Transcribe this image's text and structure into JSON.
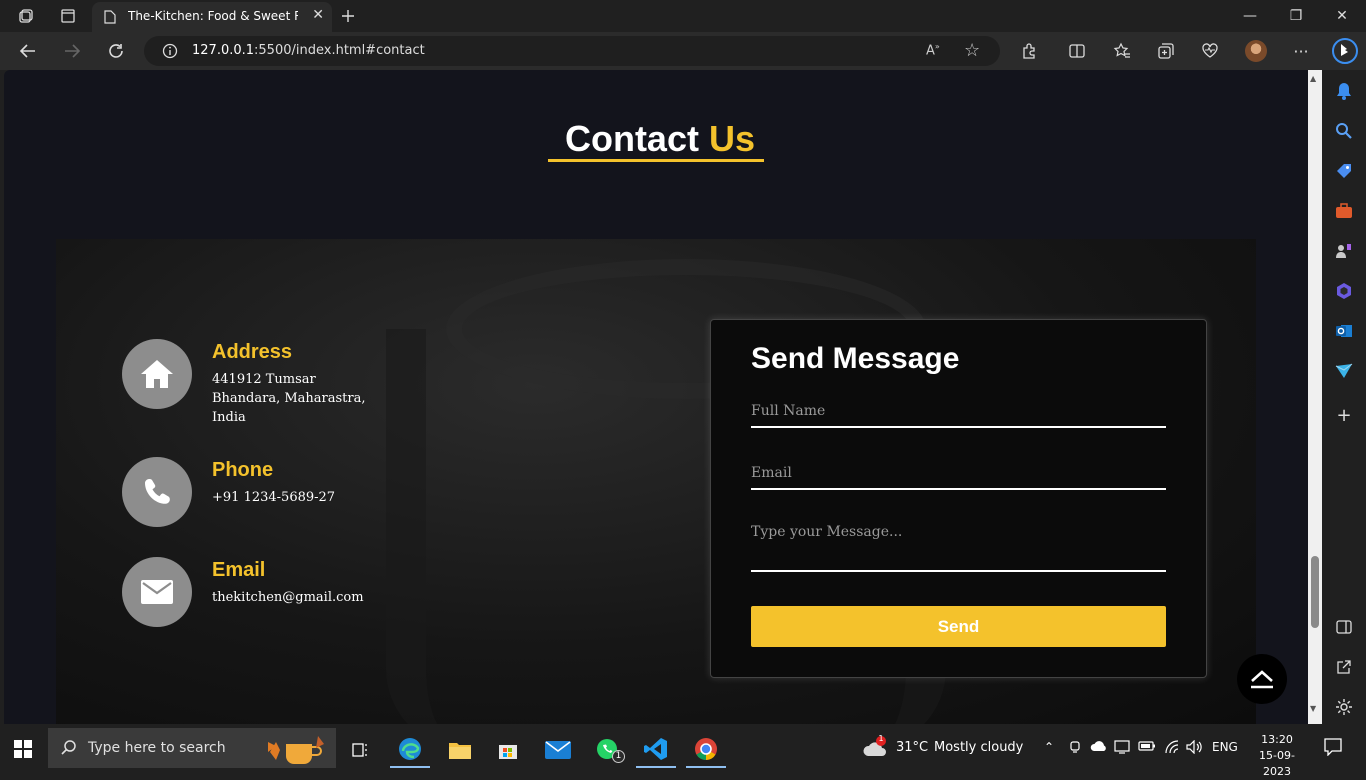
{
  "browser": {
    "tab_title": "The-Kitchen: Food & Sweet Resto",
    "url_host": "127.0.0.1",
    "url_rest": ":5500/index.html#contact"
  },
  "contact": {
    "title_part1": "Contact",
    "title_part2": "Us",
    "address": {
      "heading": "Address",
      "line1": "441912 Tumsar",
      "line2": "Bhandara, Maharastra,",
      "line3": "India"
    },
    "phone": {
      "heading": "Phone",
      "value": "+91 1234-5689-27"
    },
    "email": {
      "heading": "Email",
      "value": "thekitchen@gmail.com"
    }
  },
  "form": {
    "title": "Send Message",
    "name_placeholder": "Full Name",
    "email_placeholder": "Email",
    "message_placeholder": "Type your Message...",
    "send_label": "Send"
  },
  "taskbar": {
    "search_placeholder": "Type here to search",
    "weather_temp": "31°C",
    "weather_text": "Mostly cloudy",
    "weather_badge": "1",
    "whatsapp_badge": "1",
    "language": "ENG",
    "time": "13:20",
    "date": "15-09-2023"
  },
  "colors": {
    "accent": "#f4c22c",
    "page_bg": "#13141c",
    "icon_circle": "#8d8d8d"
  }
}
